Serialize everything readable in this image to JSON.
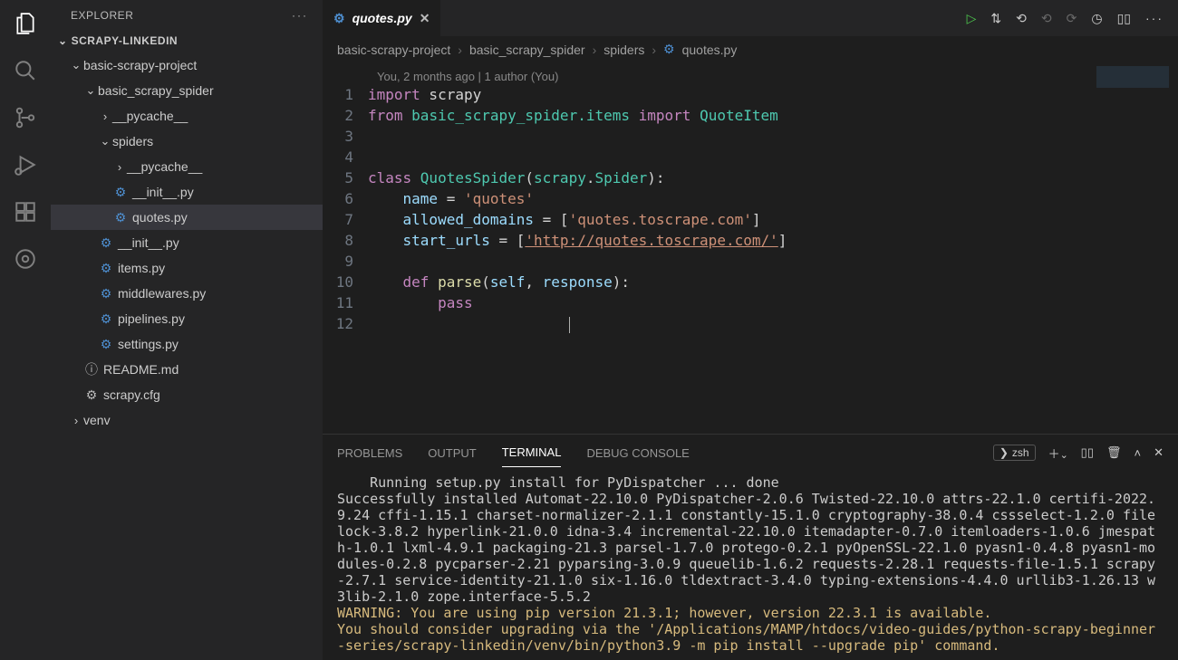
{
  "activity_icons": [
    "files",
    "search",
    "source-control",
    "run-debug",
    "extensions",
    "remote"
  ],
  "explorer": {
    "title": "EXPLORER",
    "workspace": "SCRAPY-LINKEDIN",
    "tree": [
      {
        "depth": 0,
        "kind": "folder",
        "open": true,
        "label": "basic-scrapy-project"
      },
      {
        "depth": 1,
        "kind": "folder",
        "open": true,
        "label": "basic_scrapy_spider"
      },
      {
        "depth": 2,
        "kind": "folder",
        "open": false,
        "label": "__pycache__"
      },
      {
        "depth": 2,
        "kind": "folder",
        "open": true,
        "label": "spiders"
      },
      {
        "depth": 3,
        "kind": "folder",
        "open": false,
        "label": "__pycache__"
      },
      {
        "depth": 3,
        "kind": "py",
        "label": "__init__.py"
      },
      {
        "depth": 3,
        "kind": "py",
        "label": "quotes.py",
        "selected": true
      },
      {
        "depth": 2,
        "kind": "py",
        "label": "__init__.py"
      },
      {
        "depth": 2,
        "kind": "py",
        "label": "items.py"
      },
      {
        "depth": 2,
        "kind": "py",
        "label": "middlewares.py"
      },
      {
        "depth": 2,
        "kind": "py",
        "label": "pipelines.py"
      },
      {
        "depth": 2,
        "kind": "py",
        "label": "settings.py"
      },
      {
        "depth": 1,
        "kind": "info",
        "label": "README.md"
      },
      {
        "depth": 1,
        "kind": "gear",
        "label": "scrapy.cfg"
      },
      {
        "depth": 0,
        "kind": "folder",
        "open": false,
        "label": "venv"
      }
    ]
  },
  "tab": {
    "filename": "quotes.py",
    "icon": "python"
  },
  "breadcrumb": [
    "basic-scrapy-project",
    "basic_scrapy_spider",
    "spiders",
    "quotes.py"
  ],
  "codelens": "You, 2 months ago | 1 author (You)",
  "line_numbers": [
    "1",
    "2",
    "3",
    "4",
    "5",
    "6",
    "7",
    "8",
    "9",
    "10",
    "11",
    "12"
  ],
  "code": {
    "l1_import": "import",
    "l1_scrapy": " scrapy",
    "l2_from": "from ",
    "l2_mod": "basic_scrapy_spider.items",
    "l2_import": " import ",
    "l2_item": "QuoteItem",
    "l5_class": "class ",
    "l5_name": "QuotesSpider",
    "l5_paren": "(",
    "l5_base1": "scrapy",
    "l5_dot": ".",
    "l5_base2": "Spider",
    "l5_close": "):",
    "l6_name": "name",
    "l6_eq": " = ",
    "l6_val": "'quotes'",
    "l7_name": "allowed_domains",
    "l7_eq": " = [",
    "l7_val": "'quotes.toscrape.com'",
    "l7_close": "]",
    "l8_name": "start_urls",
    "l8_eq": " = [",
    "l8_val": "'http://quotes.toscrape.com/'",
    "l8_close": "]",
    "l10_def": "def ",
    "l10_fn": "parse",
    "l10_open": "(",
    "l10_self": "self",
    "l10_comma": ", ",
    "l10_resp": "response",
    "l10_close": "):",
    "l11_pass": "pass"
  },
  "panel": {
    "tabs": [
      "PROBLEMS",
      "OUTPUT",
      "TERMINAL",
      "DEBUG CONSOLE"
    ],
    "active": 2,
    "shell": "zsh",
    "output_plain": "    Running setup.py install for PyDispatcher ... done\nSuccessfully installed Automat-22.10.0 PyDispatcher-2.0.6 Twisted-22.10.0 attrs-22.1.0 certifi-2022.9.24 cffi-1.15.1 charset-normalizer-2.1.1 constantly-15.1.0 cryptography-38.0.4 cssselect-1.2.0 filelock-3.8.2 hyperlink-21.0.0 idna-3.4 incremental-22.10.0 itemadapter-0.7.0 itemloaders-1.0.6 jmespath-1.0.1 lxml-4.9.1 packaging-21.3 parsel-1.7.0 protego-0.2.1 pyOpenSSL-22.1.0 pyasn1-0.4.8 pyasn1-modules-0.2.8 pycparser-2.21 pyparsing-3.0.9 queuelib-1.6.2 requests-2.28.1 requests-file-1.5.1 scrapy-2.7.1 service-identity-21.1.0 six-1.16.0 tldextract-3.4.0 typing-extensions-4.4.0 urllib3-1.26.13 w3lib-2.1.0 zope.interface-5.5.2",
    "output_warn": "WARNING: You are using pip version 21.3.1; however, version 22.3.1 is available.\nYou should consider upgrading via the '/Applications/MAMP/htdocs/video-guides/python-scrapy-beginner-series/scrapy-linkedin/venv/bin/python3.9 -m pip install --upgrade pip' command."
  }
}
